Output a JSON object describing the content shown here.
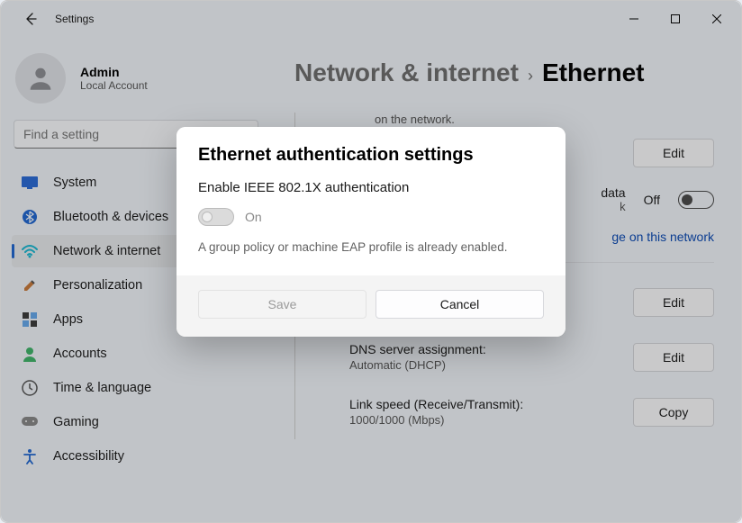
{
  "titlebar": {
    "title": "Settings"
  },
  "profile": {
    "name": "Admin",
    "subtitle": "Local Account"
  },
  "search": {
    "placeholder": "Find a setting"
  },
  "sidebar": {
    "items": [
      {
        "label": "System"
      },
      {
        "label": "Bluetooth & devices"
      },
      {
        "label": "Network & internet"
      },
      {
        "label": "Personalization"
      },
      {
        "label": "Apps"
      },
      {
        "label": "Accounts"
      },
      {
        "label": "Time & language"
      },
      {
        "label": "Gaming"
      },
      {
        "label": "Accessibility"
      }
    ],
    "active_index": 2
  },
  "breadcrumb": {
    "parent": "Network & internet",
    "leaf": "Ethernet"
  },
  "page": {
    "top_fragment": "on the network.",
    "edit_label": "Edit",
    "copy_label": "Copy",
    "metered": {
      "fragment_right": "data",
      "fragment_right2": "k",
      "state": "Off"
    },
    "usage_link_fragment": "ge on this network",
    "dns": {
      "title": "DNS server assignment:",
      "value": "Automatic (DHCP)"
    },
    "link_speed": {
      "title": "Link speed (Receive/Transmit):",
      "value": "1000/1000 (Mbps)"
    }
  },
  "dialog": {
    "title": "Ethernet authentication settings",
    "subtitle": "Enable IEEE 802.1X authentication",
    "toggle_label": "On",
    "hint": "A group policy or machine EAP profile is already enabled.",
    "save": "Save",
    "cancel": "Cancel"
  }
}
